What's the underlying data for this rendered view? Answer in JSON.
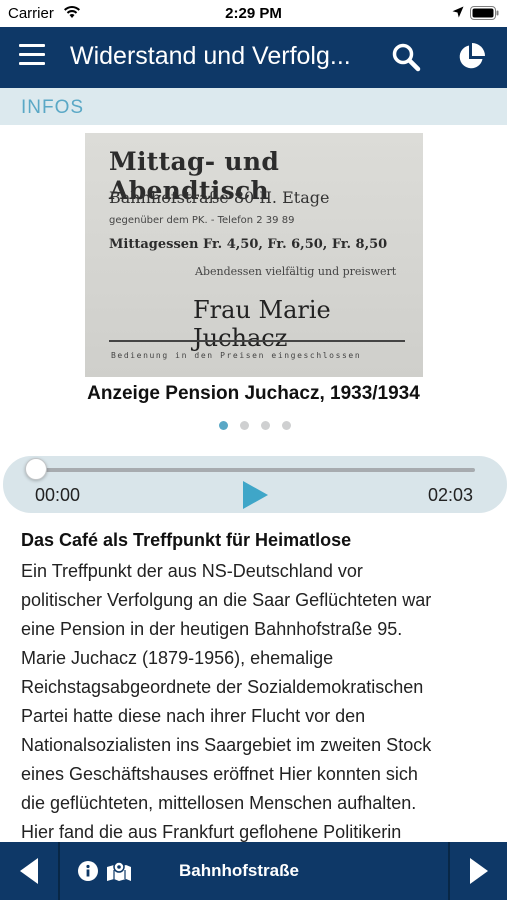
{
  "status_bar": {
    "carrier": "Carrier",
    "time": "2:29 PM"
  },
  "nav": {
    "title": "Widerstand und Verfolg...",
    "icons": [
      "menu-icon",
      "search-icon",
      "pie-chart-icon"
    ]
  },
  "section": {
    "label": "INFOS"
  },
  "image": {
    "lines": [
      "Mittag- und Abendtisch",
      "Bahnhofstraße 80 II. Etage",
      "gegenüber dem PK. - Telefon 2 39 89",
      "Mittagessen Fr. 4,50, Fr. 6,50, Fr. 8,50",
      "Abendessen vielfältig und preiswert",
      "Frau Marie Juchacz",
      "Bedienung in den Preisen eingeschlossen"
    ],
    "caption": "Anzeige Pension Juchacz, 1933/1934",
    "pager": {
      "count": 4,
      "active": 0
    }
  },
  "player": {
    "current": "00:00",
    "duration": "02:03",
    "progress": 0
  },
  "article": {
    "title": "Das Café als Treffpunkt für Heimatlose",
    "lines": [
      "Ein Treffpunkt der aus NS-Deutschland vor",
      "politischer Verfolgung an die Saar Geflüchteten war",
      "eine Pension in der heutigen Bahnhofstraße 95.",
      "Marie Juchacz (1879-1956), ehemalige",
      "Reichstagsabgeordnete der Sozialdemokratischen",
      "Partei hatte diese nach ihrer Flucht vor den",
      "Nationalsozialisten ins Saargebiet im zweiten Stock",
      "eines Geschäftshauses eröffnet Hier konnten sich",
      "die geflüchteten, mittellosen Menschen aufhalten.",
      "Hier fand die aus Frankfurt geflohene Politikerin"
    ]
  },
  "bottom_bar": {
    "location": "Bahnhofstraße"
  },
  "colors": {
    "nav_bg": "#0e3867",
    "section_bg": "#dce9ee",
    "accent": "#5aa8c6",
    "player_bg": "#d9e5ea"
  }
}
